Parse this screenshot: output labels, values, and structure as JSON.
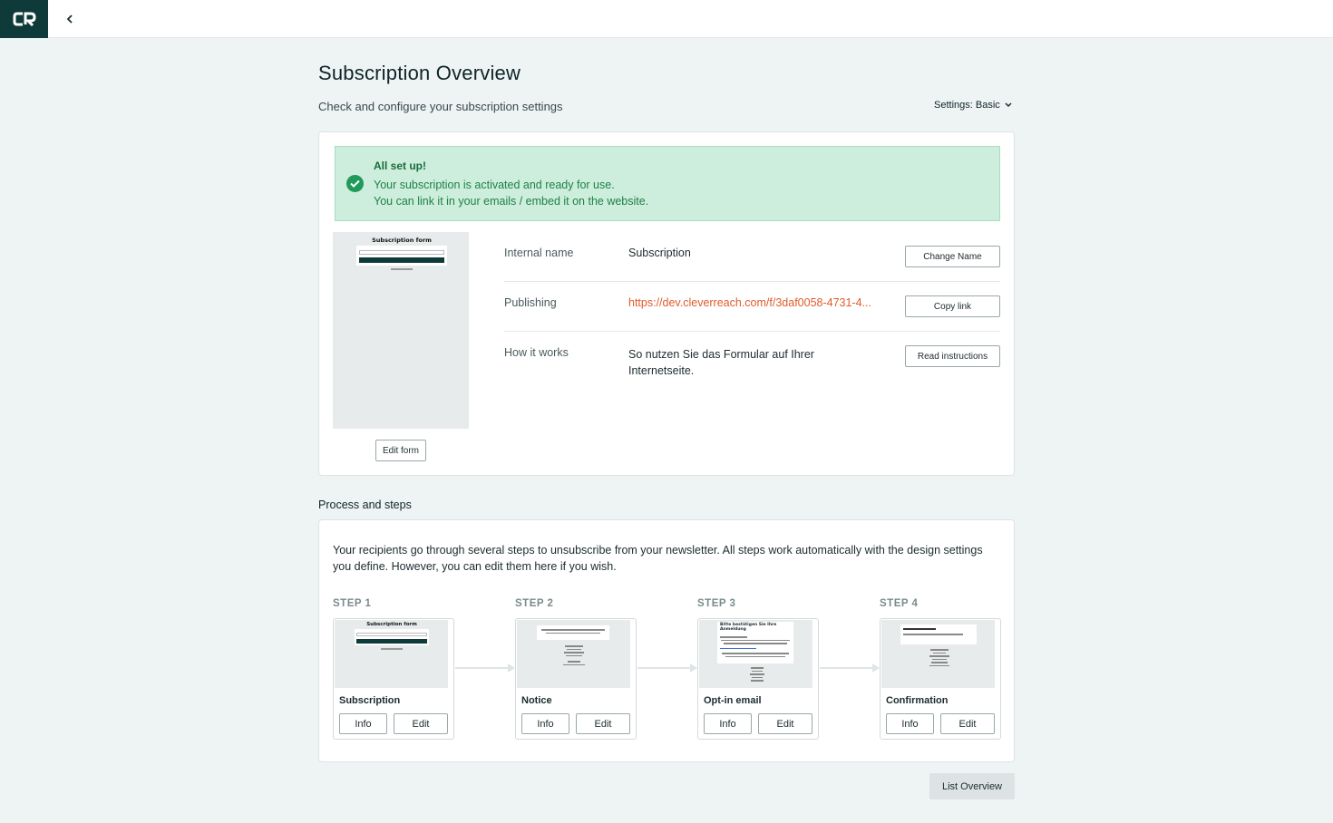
{
  "topbar": {
    "logo_text": "CR"
  },
  "header": {
    "title": "Subscription Overview",
    "subtitle": "Check and configure your subscription settings",
    "settings_label": "Settings: Basic"
  },
  "alert": {
    "title": "All set up!",
    "line1": "Your subscription is activated and ready for use.",
    "line2": "You can link it in your emails / embed it on the website."
  },
  "preview": {
    "form_title": "Subscription form",
    "edit_button": "Edit form"
  },
  "details": [
    {
      "label": "Internal name",
      "value": "Subscription",
      "button": "Change Name"
    },
    {
      "label": "Publishing",
      "value": "https://dev.cleverreach.com/f/3daf0058-4731-4...",
      "button": "Copy link"
    },
    {
      "label": "How it works",
      "value": "So nutzen Sie das Formular auf Ihrer Internetseite.",
      "button": "Read instructions"
    }
  ],
  "process": {
    "title": "Process and steps",
    "description": "Your recipients go through several steps to unsubscribe from your newsletter. All steps work automatically with the design settings you define. However, you can edit them here if you wish.",
    "steps": [
      {
        "label": "STEP 1",
        "name": "Subscription",
        "info": "Info",
        "edit": "Edit",
        "thumb_title": "Subscription form"
      },
      {
        "label": "STEP 2",
        "name": "Notice",
        "info": "Info",
        "edit": "Edit"
      },
      {
        "label": "STEP 3",
        "name": "Opt-in email",
        "info": "Info",
        "edit": "Edit",
        "thumb_title": "Bitte bestätigen Sie Ihre Anmeldung"
      },
      {
        "label": "STEP 4",
        "name": "Confirmation",
        "info": "Info",
        "edit": "Edit"
      }
    ]
  },
  "footer": {
    "list_overview": "List Overview"
  },
  "colors": {
    "brand": "#0f3a3a",
    "success_bg": "#cdeedc",
    "success_text": "#1f8048",
    "link": "#e05b2a"
  }
}
